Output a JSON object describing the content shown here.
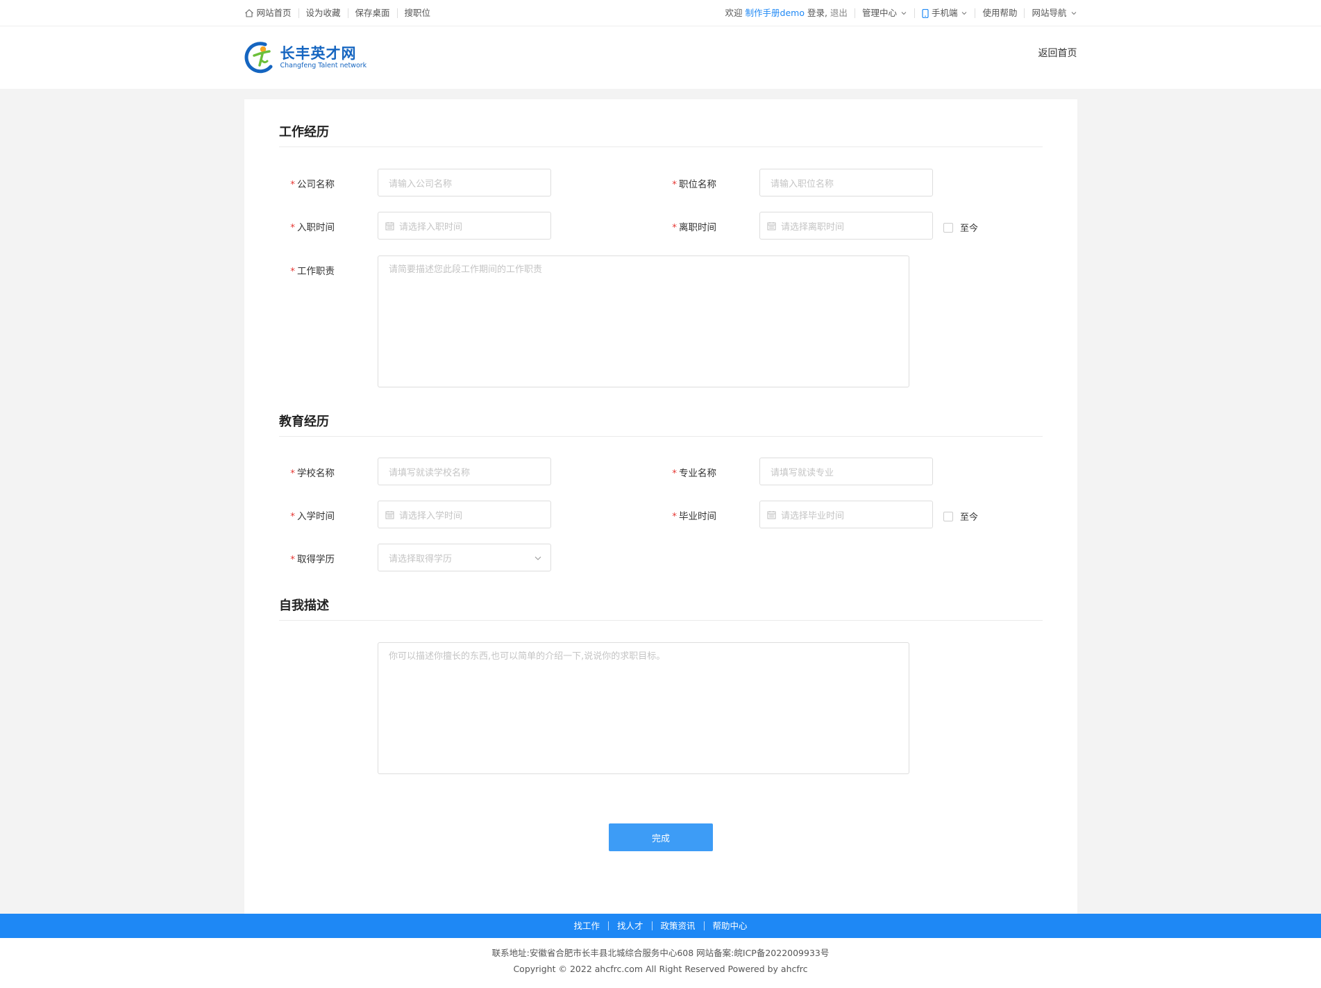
{
  "topbar": {
    "links": [
      "网站首页",
      "设为收藏",
      "保存桌面",
      "搜职位"
    ],
    "welcome_prefix": "欢迎",
    "username": "制作手册demo",
    "login_suffix": "登录,",
    "logout": "退出",
    "manage_center": "管理中心",
    "mobile": "手机端",
    "help": "使用帮助",
    "site_nav": "网站导航"
  },
  "header": {
    "logo_cn": "长丰英才网",
    "logo_en": "Changfeng Talent network",
    "back_home": "返回首页"
  },
  "work": {
    "title": "工作经历",
    "company_label": "公司名称",
    "company_placeholder": "请输入公司名称",
    "position_label": "职位名称",
    "position_placeholder": "请输入职位名称",
    "start_label": "入职时间",
    "start_placeholder": "请选择入职时间",
    "end_label": "离职时间",
    "end_placeholder": "请选择离职时间",
    "until_now": "至今",
    "duty_label": "工作职责",
    "duty_placeholder": "请简要描述您此段工作期间的工作职责"
  },
  "edu": {
    "title": "教育经历",
    "school_label": "学校名称",
    "school_placeholder": "请填写就读学校名称",
    "major_label": "专业名称",
    "major_placeholder": "请填写就读专业",
    "start_label": "入学时间",
    "start_placeholder": "请选择入学时间",
    "end_label": "毕业时间",
    "end_placeholder": "请选择毕业时间",
    "until_now": "至今",
    "degree_label": "取得学历",
    "degree_placeholder": "请选择取得学历"
  },
  "self": {
    "title": "自我描述",
    "placeholder": "你可以描述你擅长的东西,也可以简单的介绍一下,说说你的求职目标。"
  },
  "submit_label": "完成",
  "footer": {
    "nav": [
      "找工作",
      "找人才",
      "政策资讯",
      "帮助中心"
    ],
    "address": "联系地址:安徽省合肥市长丰县北城综合服务中心608 网站备案:皖ICP备2022009933号",
    "copyright": "Copyright © 2022 ahcfrc.com All Right Reserved Powered by ahcfrc"
  },
  "colors": {
    "accent": "#1e88f5",
    "button": "#3d9cf6",
    "required": "#e53935"
  }
}
